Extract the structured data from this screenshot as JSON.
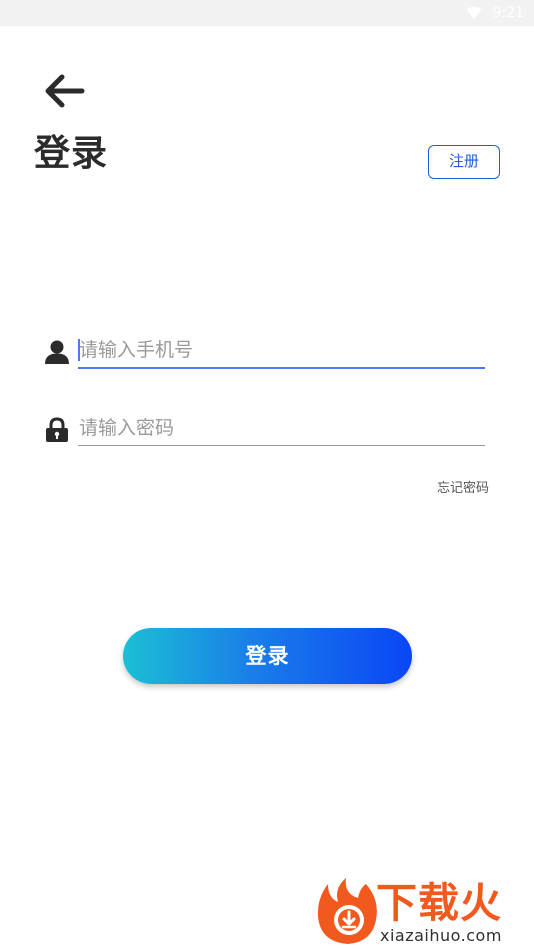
{
  "status_bar": {
    "time": "9:21",
    "wifi_icon": "wifi-icon"
  },
  "header": {
    "back_icon": "arrow-left-icon",
    "title": "登录",
    "register_label": "注册"
  },
  "form": {
    "phone": {
      "icon": "user-icon",
      "placeholder": "请输入手机号",
      "value": ""
    },
    "password": {
      "icon": "lock-icon",
      "placeholder": "请输入密码",
      "value": ""
    },
    "forgot_label": "忘记密码",
    "submit_label": "登录"
  },
  "colors": {
    "accent": "#1e5ed8",
    "input_focus": "#4a7cf0",
    "button_gradient_start": "#1bbfd4",
    "button_gradient_end": "#0a46f5",
    "watermark": "#f2591e"
  },
  "watermark": {
    "logo_icon": "flame-download-icon",
    "text": "下载火",
    "url": "xiazaihuo.com"
  }
}
